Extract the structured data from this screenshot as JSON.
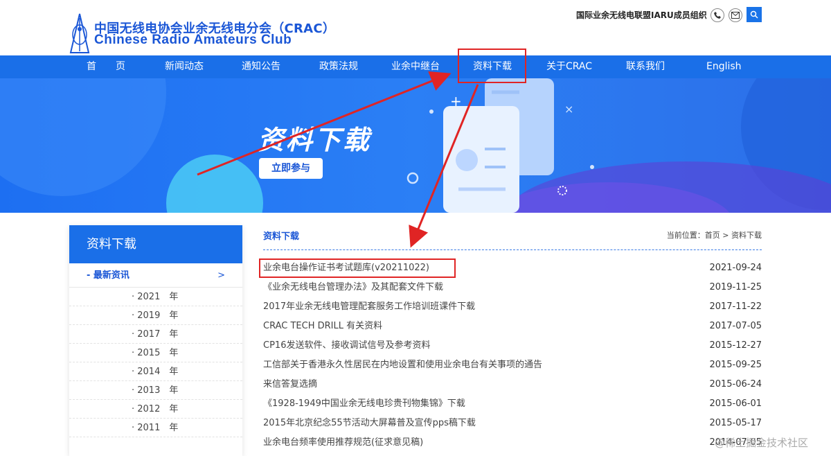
{
  "header": {
    "logo_cn": "中国无线电协会业余无线电分会（CRAC）",
    "logo_en": "Chinese Radio Amateurs Club",
    "iaru_text": "国际业余无线电联盟IARU成员组织"
  },
  "nav": {
    "items": [
      "首　　页",
      "新闻动态",
      "通知公告",
      "政策法规",
      "业余中继台",
      "资料下载",
      "关于CRAC",
      "联系我们",
      "English"
    ],
    "active_index": 5
  },
  "banner": {
    "title": "资料下载",
    "button": "立即参与"
  },
  "sidebar": {
    "title": "资料下载",
    "category": "- 最新资讯",
    "category_chevron": ">",
    "years": [
      "· 2021　年",
      "· 2019　年",
      "· 2017　年",
      "· 2015　年",
      "· 2014　年",
      "· 2013　年",
      "· 2012　年",
      "· 2011　年"
    ]
  },
  "main": {
    "title": "资料下载",
    "breadcrumb": "当前位置：首页 > 资料下载",
    "rows": [
      {
        "title": "业余电台操作证书考试题库(v20211022)",
        "date": "2021-09-24"
      },
      {
        "title": "《业余无线电台管理办法》及其配套文件下载",
        "date": "2019-11-25"
      },
      {
        "title": "2017年业余无线电管理配套服务工作培训班课件下载",
        "date": "2017-11-22"
      },
      {
        "title": "CRAC TECH DRILL 有关资料",
        "date": "2017-07-05"
      },
      {
        "title": "CP16发送软件、接收调试信号及参考资料",
        "date": "2015-12-27"
      },
      {
        "title": "工信部关于香港永久性居民在内地设置和使用业余电台有关事项的通告",
        "date": "2015-09-25"
      },
      {
        "title": "来信答复选摘",
        "date": "2015-06-24"
      },
      {
        "title": "《1928-1949中国业余无线电珍贵刊物集锦》下载",
        "date": "2015-06-01"
      },
      {
        "title": "2015年北京纪念55节活动大屏幕普及宣传pps稿下载",
        "date": "2015-05-17"
      },
      {
        "title": "业余电台频率使用推荐规范(征求意见稿)",
        "date": "2014-07-05"
      }
    ]
  },
  "watermark": "@稀土掘金技术社区",
  "colors": {
    "brand_blue": "#1a6fe8",
    "annotation_red": "#e02424"
  }
}
